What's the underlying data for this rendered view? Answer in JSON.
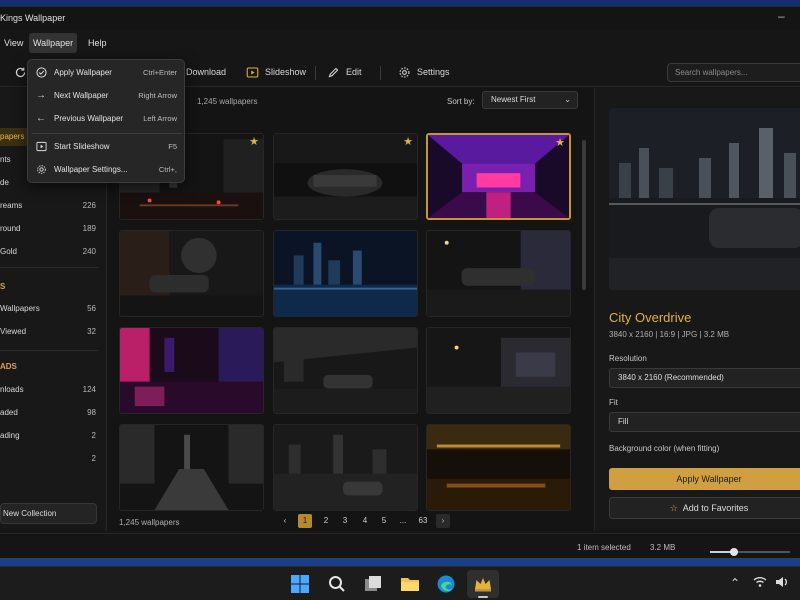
{
  "app": {
    "title": "Kings Wallpaper"
  },
  "menubar": {
    "view": "View",
    "wallpaper": "Wallpaper",
    "help": "Help"
  },
  "toolbar": {
    "download": "Download",
    "slideshow": "Slideshow",
    "edit": "Edit",
    "settings": "Settings",
    "search_placeholder": "Search wallpapers..."
  },
  "dropdown": {
    "items": [
      {
        "label": "Apply Wallpaper",
        "shortcut": "Ctrl+Enter",
        "icon": "check-circle-icon"
      },
      {
        "label": "Next Wallpaper",
        "shortcut": "Right Arrow",
        "icon": "arrow-right-icon"
      },
      {
        "label": "Previous Wallpaper",
        "shortcut": "Left Arrow",
        "icon": "arrow-left-icon"
      },
      {
        "label": "Start Slideshow",
        "shortcut": "F5",
        "icon": "slideshow-icon"
      },
      {
        "label": "Wallpaper Settings...",
        "shortcut": "Ctrl+,",
        "icon": "gear-icon"
      }
    ]
  },
  "sidebar": {
    "items": [
      {
        "label": "papers",
        "count": ""
      },
      {
        "label": "nts",
        "count": ""
      },
      {
        "label": "de",
        "count": ""
      },
      {
        "label": "reams",
        "count": "226"
      },
      {
        "label": "round",
        "count": "189"
      },
      {
        "label": "Gold",
        "count": "240"
      }
    ],
    "section2": "S",
    "items2": [
      {
        "label": "Wallpapers",
        "count": "56"
      },
      {
        "label": "Viewed",
        "count": "32"
      }
    ],
    "section3": "ADS",
    "items3": [
      {
        "label": "nloads",
        "count": "124"
      },
      {
        "label": "aded",
        "count": "98"
      },
      {
        "label": "ading",
        "count": "2"
      },
      {
        "label": "",
        "count": "2"
      }
    ],
    "new_collection": "New Collection"
  },
  "gallery": {
    "title_fragment": "s",
    "count": "1,245 wallpapers",
    "sort_label": "Sort by:",
    "sort_value": "Newest First",
    "footer_count": "1,245 wallpapers",
    "pages": [
      "1",
      "2",
      "3",
      "4",
      "5",
      "...",
      "63"
    ]
  },
  "details": {
    "title": "City Overdrive",
    "meta": "3840 x 2160   |   16:9   |   JPG   |   3.2 MB",
    "resolution_label": "Resolution",
    "resolution_value": "3840 x 2160  (Recommended)",
    "fit_label": "Fit",
    "fit_value": "Fill",
    "bg_label": "Background color (when fitting)",
    "apply": "Apply Wallpaper",
    "favorite": "Add to Favorites"
  },
  "status": {
    "selected": "1 item selected",
    "size": "3.2 MB",
    "zoom_fraction": 0.3
  },
  "colors": {
    "accent": "#d0a040",
    "accent_text": "#e3b23c",
    "bg": "#161616"
  }
}
